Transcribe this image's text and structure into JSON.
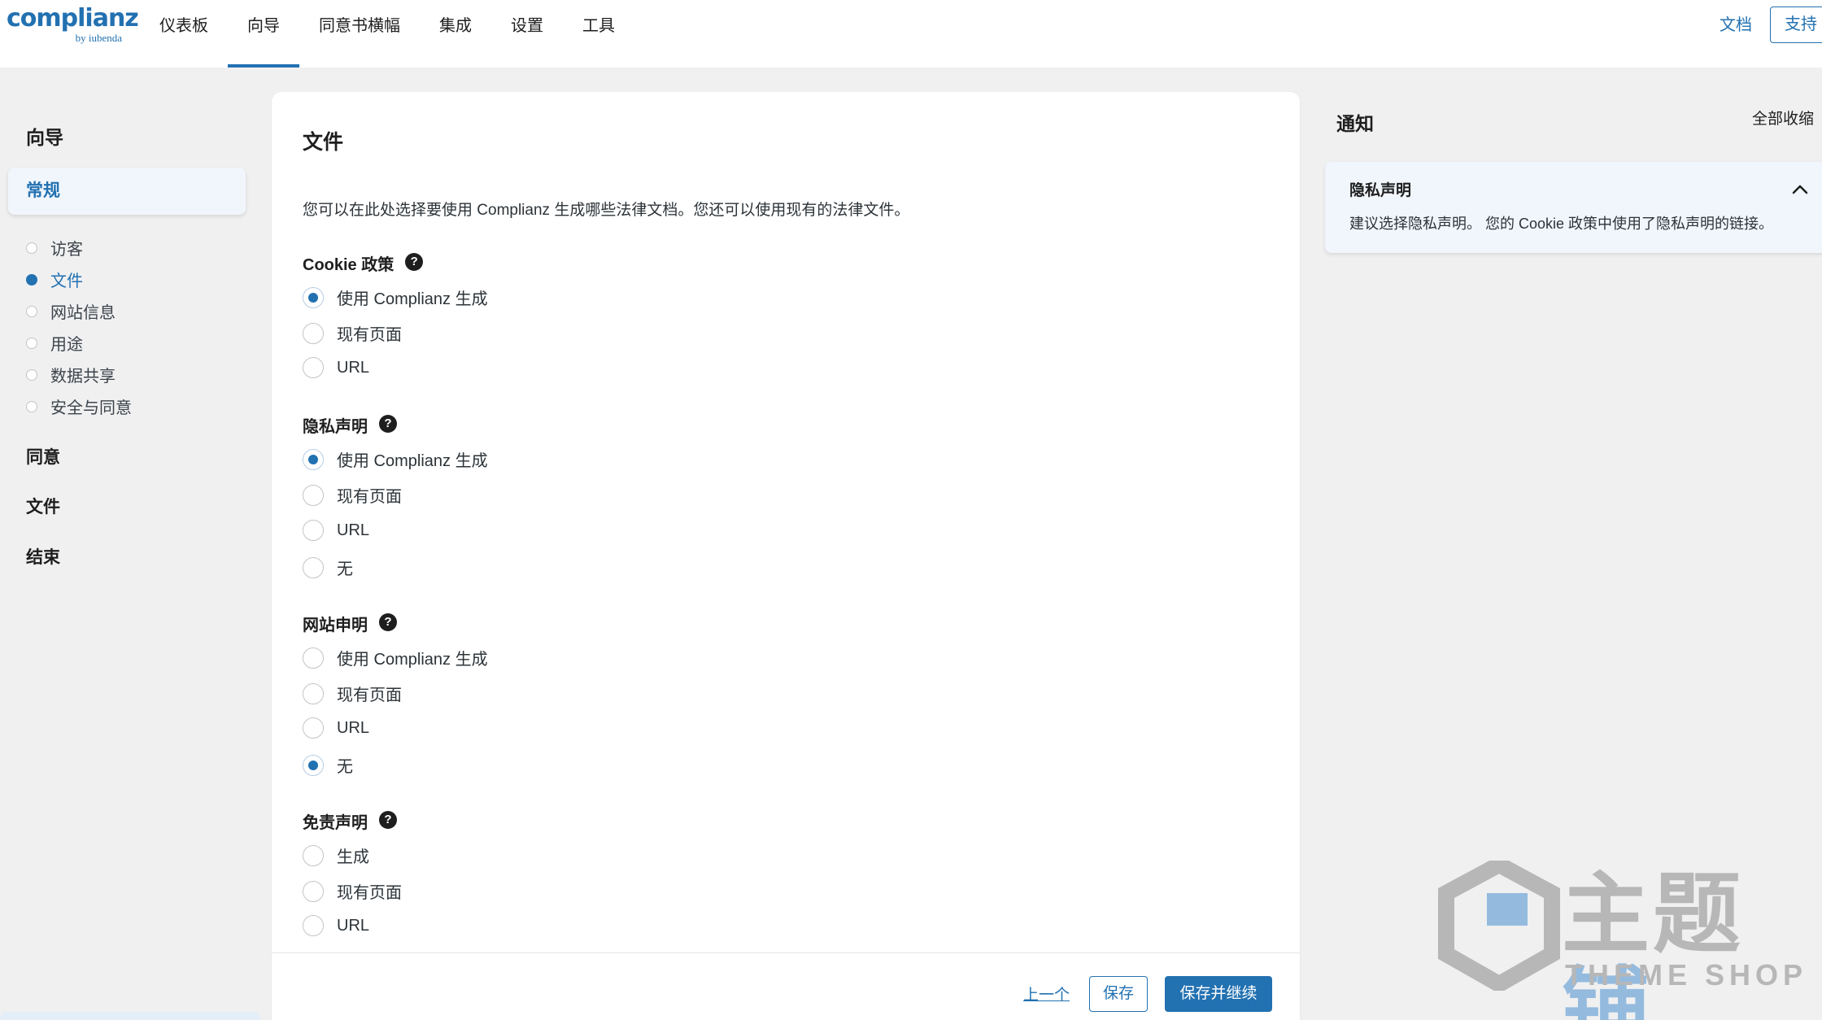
{
  "header": {
    "logo_main": "complianz",
    "logo_sub": "by iubenda",
    "nav": [
      "仪表板",
      "向导",
      "同意书横幅",
      "集成",
      "设置",
      "工具"
    ],
    "nav_active_index": 1,
    "docs_label": "文档",
    "support_label": "支持"
  },
  "sidebar": {
    "title": "向导",
    "active_section": "常规",
    "steps": [
      {
        "label": "访客",
        "active": false
      },
      {
        "label": "文件",
        "active": true
      },
      {
        "label": "网站信息",
        "active": false
      },
      {
        "label": "用途",
        "active": false
      },
      {
        "label": "数据共享",
        "active": false
      },
      {
        "label": "安全与同意",
        "active": false
      }
    ],
    "groups": [
      "同意",
      "文件",
      "结束"
    ]
  },
  "main": {
    "title": "文件",
    "description": "您可以在此处选择要使用 Complianz 生成哪些法律文档。您还可以使用现有的法律文件。",
    "fields": [
      {
        "label": "Cookie 政策",
        "options": [
          {
            "label": "使用 Complianz 生成",
            "checked": true
          },
          {
            "label": "现有页面",
            "checked": false
          },
          {
            "label": "URL",
            "checked": false
          }
        ]
      },
      {
        "label": "隐私声明",
        "options": [
          {
            "label": "使用 Complianz 生成",
            "checked": true
          },
          {
            "label": "现有页面",
            "checked": false
          },
          {
            "label": "URL",
            "checked": false
          },
          {
            "label": "无",
            "checked": false
          }
        ]
      },
      {
        "label": "网站申明",
        "options": [
          {
            "label": "使用 Complianz 生成",
            "checked": false
          },
          {
            "label": "现有页面",
            "checked": false
          },
          {
            "label": "URL",
            "checked": false
          },
          {
            "label": "无",
            "checked": true
          }
        ]
      },
      {
        "label": "免责声明",
        "options": [
          {
            "label": "生成",
            "checked": false
          },
          {
            "label": "现有页面",
            "checked": false
          },
          {
            "label": "URL",
            "checked": false
          }
        ]
      }
    ],
    "footer": {
      "prev_label": "上一个",
      "save_label": "保存",
      "save_continue_label": "保存并继续"
    }
  },
  "notifications": {
    "title": "通知",
    "collapse_all": "全部收缩",
    "items": [
      {
        "title": "隐私声明",
        "text": "建议选择隐私声明。 您的 Cookie 政策中使用了隐私声明的链接。"
      }
    ]
  },
  "watermark": {
    "text_grey": "主题",
    "text_blue": "铺",
    "sub": "THEME SHOP"
  },
  "colors": {
    "accent": "#2271b1",
    "background": "#f0f0f1",
    "notification_bg": "#f0f6fc"
  },
  "icons": {
    "help": "question-circle-icon",
    "collapse": "chevron-up-icon",
    "help_glyph": "?"
  }
}
